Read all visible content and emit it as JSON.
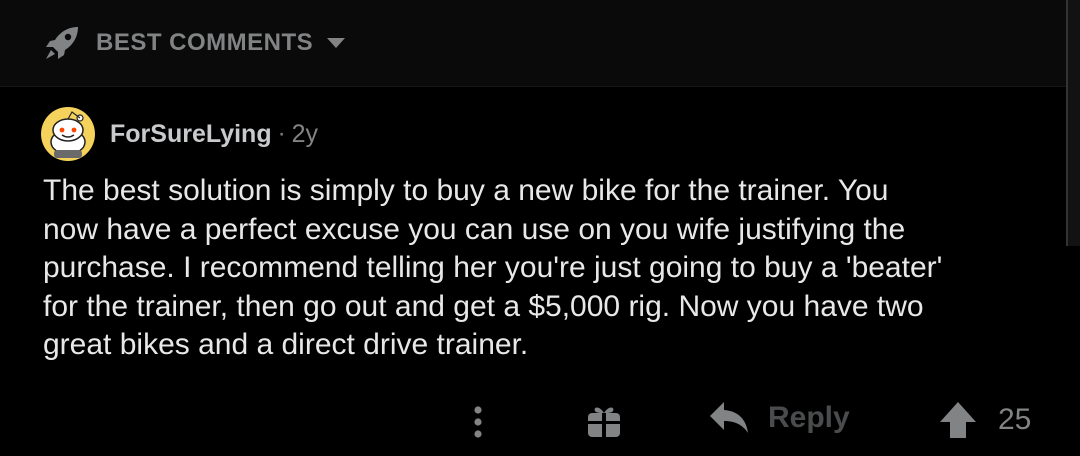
{
  "header": {
    "sort_label": "BEST COMMENTS",
    "sort_icon": "rocket-icon",
    "dropdown_icon": "caret-down-icon"
  },
  "comment": {
    "author": "ForSureLying",
    "separator": "·",
    "age": "2y",
    "avatar_icon": "snoo-avatar",
    "body": "The best solution is simply to buy a new bike for the trainer.  You\nnow have a perfect excuse you can use on you wife justifying the\npurchase.  I recommend telling her you're just going to buy a 'beater'\nfor the trainer, then go out and get a $5,000 rig.  Now you have two\ngreat bikes and a direct drive trainer.",
    "actions": {
      "more_icon": "more-vertical-icon",
      "award_icon": "gift-icon",
      "reply_icon": "reply-arrow-icon",
      "reply_label": "Reply",
      "upvote_icon": "upvote-arrow-icon",
      "score": "25"
    }
  },
  "colors": {
    "background": "#000000",
    "header_bg": "#0a0a0a",
    "muted": "#818384",
    "text": "#e8e8e8"
  }
}
